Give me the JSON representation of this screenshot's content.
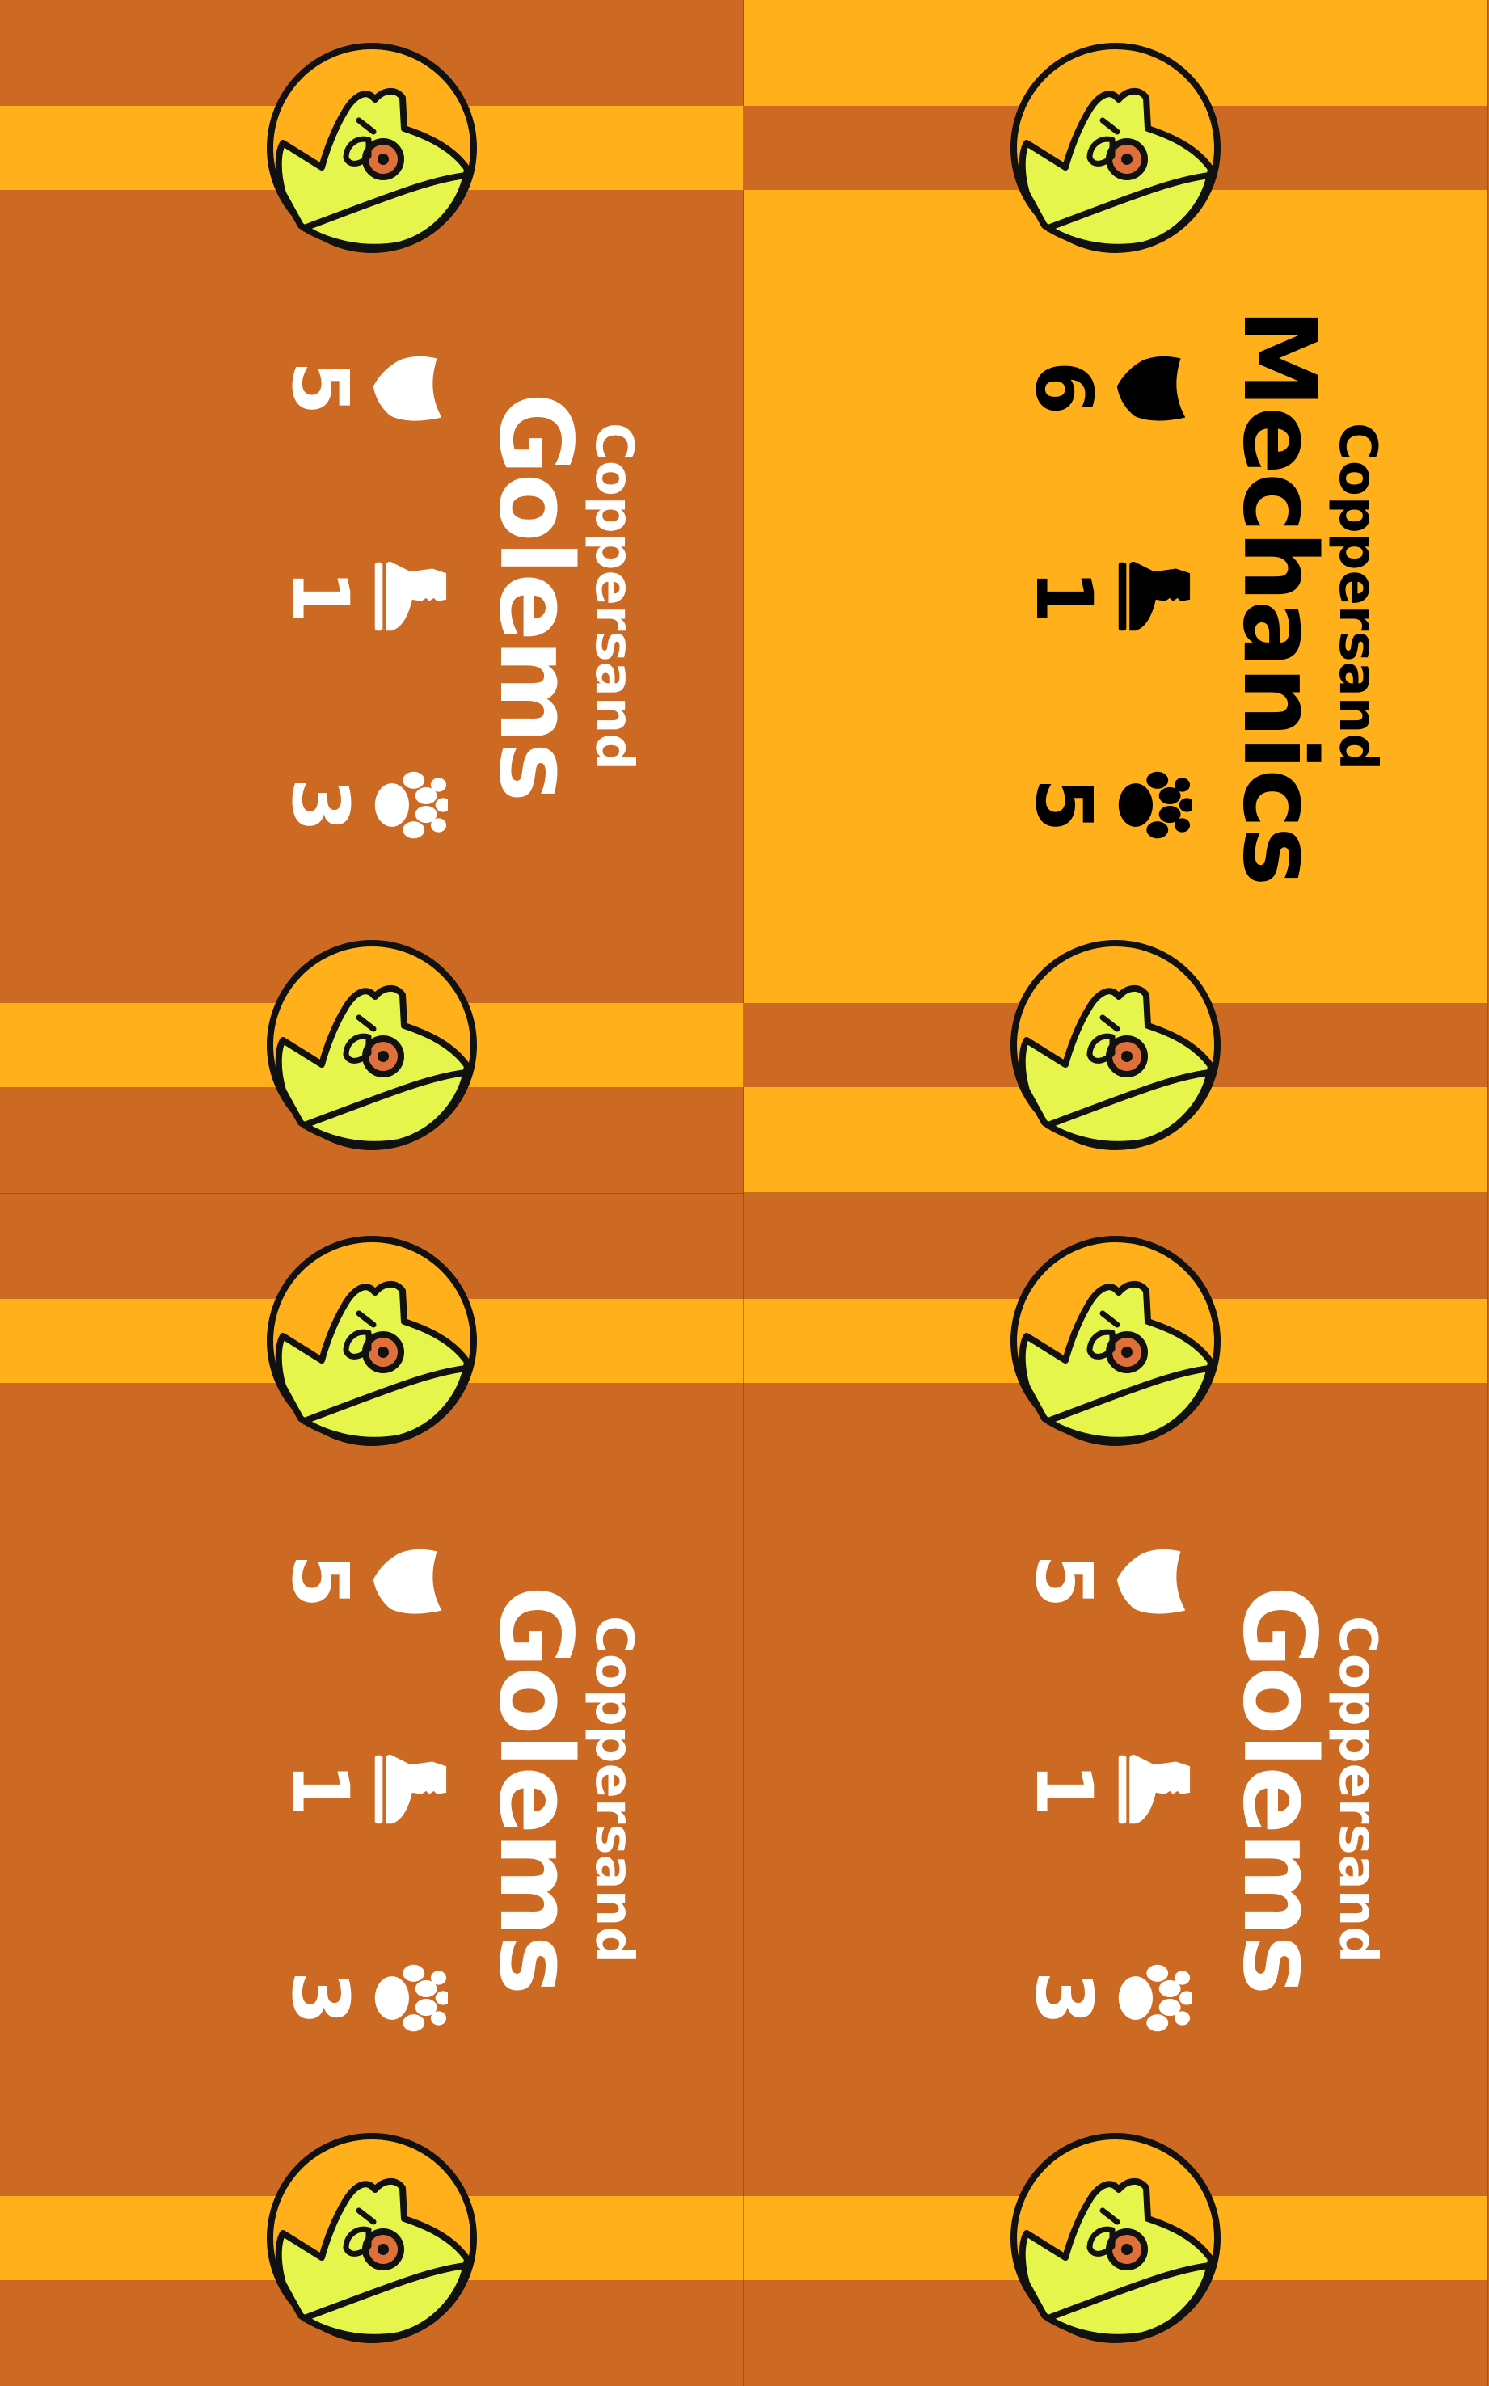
{
  "sheet": {
    "cards": [
      {
        "position": "bottom-left",
        "faction": "Coppersand",
        "unit": "Golems",
        "attack": "3",
        "move": "1",
        "defense": "5",
        "background": "#CC6A24",
        "stripe": "#FFB01B",
        "text_color": "#FFFFFF"
      },
      {
        "position": "top-left",
        "faction": "Coppersand",
        "unit": "Golems",
        "attack": "3",
        "move": "1",
        "defense": "5",
        "background": "#CC6A24",
        "stripe": "#FFB01B",
        "text_color": "#FFFFFF"
      },
      {
        "position": "bottom-right",
        "faction": "Coppersand",
        "unit": "Mechanics",
        "attack": "5",
        "move": "1",
        "defense": "6",
        "background": "#FFB01B",
        "stripe": "#CC6A24",
        "text_color": "#000000"
      },
      {
        "position": "top-right",
        "faction": "Coppersand",
        "unit": "Golems",
        "attack": "3",
        "move": "1",
        "defense": "5",
        "background": "#CC6A24",
        "stripe": "#FFB01B",
        "text_color": "#FFFFFF"
      }
    ],
    "icons": {
      "attack": "paw-print-icon",
      "move": "boot-icon",
      "defense": "shield-icon",
      "emblem": "golem-head-emblem-icon"
    },
    "emblem_colors": {
      "fill": "#FFB01B",
      "face": "#E5F54B",
      "eye": "#E0703A",
      "outline": "#111111"
    }
  }
}
